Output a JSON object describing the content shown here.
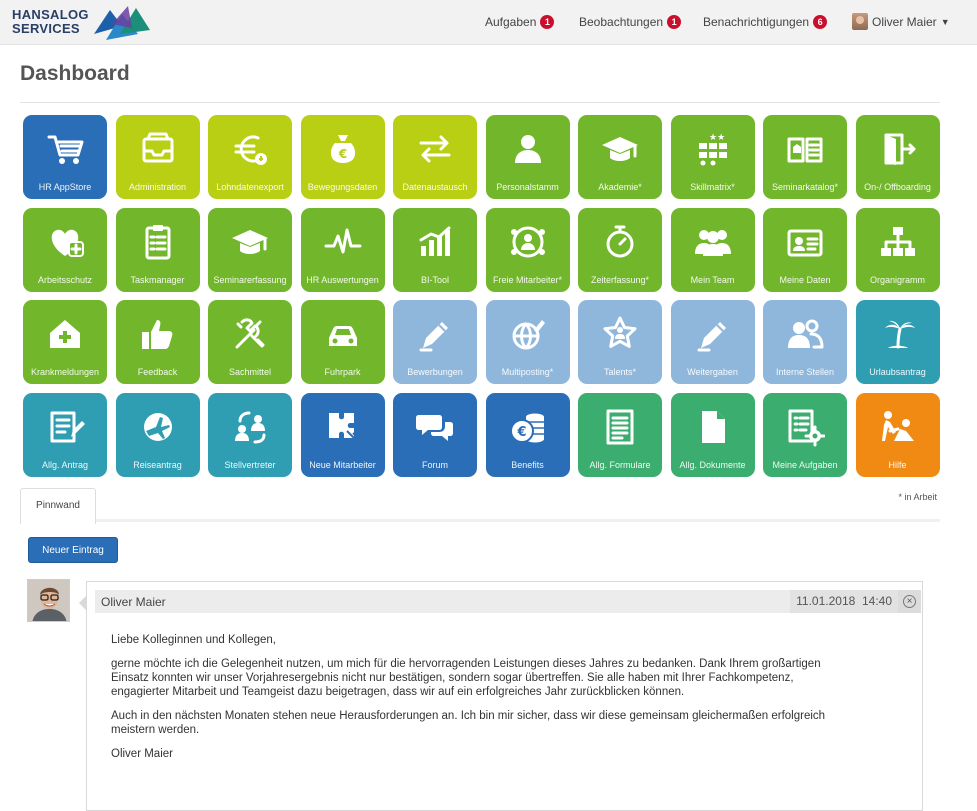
{
  "brand": {
    "line1": "HANSALOG",
    "line2": "SERVICES"
  },
  "nav": [
    {
      "label": "Aufgaben",
      "count": "1"
    },
    {
      "label": "Beobachtungen",
      "count": "1"
    },
    {
      "label": "Benachrichtigungen",
      "count": "6"
    }
  ],
  "user": {
    "name": "Oliver Maier"
  },
  "page_title": "Dashboard",
  "colors": {
    "blue_dark": "#2a6eb7",
    "lime": "#b9cf14",
    "green": "#72b62b",
    "light_blue": "#8fb7dc",
    "teal": "#2f9eb3",
    "emerald": "#3aad6f",
    "orange": "#f08a13"
  },
  "tiles": [
    {
      "label": "HR AppStore",
      "icon": "cart-icon",
      "color": "blue_dark"
    },
    {
      "label": "Administration",
      "icon": "inbox-icon",
      "color": "lime"
    },
    {
      "label": "Lohndatenexport",
      "icon": "euro-icon",
      "color": "lime"
    },
    {
      "label": "Bewegungsdaten",
      "icon": "money-bag-icon",
      "color": "lime"
    },
    {
      "label": "Datenaustausch",
      "icon": "exchange-icon",
      "color": "lime"
    },
    {
      "label": "Personalstamm",
      "icon": "person-icon",
      "color": "green"
    },
    {
      "label": "Akademie*",
      "icon": "graduation-cap-icon",
      "color": "green"
    },
    {
      "label": "Skillmatrix*",
      "icon": "skill-matrix-icon",
      "color": "green"
    },
    {
      "label": "Seminarkatalog*",
      "icon": "catalog-icon",
      "color": "green"
    },
    {
      "label": "On-/ Offboarding",
      "icon": "door-exit-icon",
      "color": "green"
    },
    {
      "label": "Arbeitsschutz",
      "icon": "heart-plus-icon",
      "color": "green"
    },
    {
      "label": "Taskmanager",
      "icon": "clipboard-list-icon",
      "color": "green"
    },
    {
      "label": "Seminarerfassung",
      "icon": "graduation-cap-icon",
      "color": "green"
    },
    {
      "label": "HR Auswertungen",
      "icon": "pulse-icon",
      "color": "green"
    },
    {
      "label": "BI-Tool",
      "icon": "bar-chart-icon",
      "color": "green"
    },
    {
      "label": "Freie Mitarbeiter*",
      "icon": "network-person-icon",
      "color": "green"
    },
    {
      "label": "Zeiterfassung*",
      "icon": "stopwatch-icon",
      "color": "green"
    },
    {
      "label": "Mein Team",
      "icon": "team-icon",
      "color": "green"
    },
    {
      "label": "Meine Daten",
      "icon": "id-card-icon",
      "color": "green"
    },
    {
      "label": "Organigramm",
      "icon": "org-chart-icon",
      "color": "green"
    },
    {
      "label": "Krankmeldungen",
      "icon": "house-cross-icon",
      "color": "green"
    },
    {
      "label": "Feedback",
      "icon": "thumbs-up-icon",
      "color": "green"
    },
    {
      "label": "Sachmittel",
      "icon": "tools-icon",
      "color": "green"
    },
    {
      "label": "Fuhrpark",
      "icon": "car-icon",
      "color": "green"
    },
    {
      "label": "Bewerbungen",
      "icon": "pen-icon",
      "color": "light_blue"
    },
    {
      "label": "Multiposting*",
      "icon": "globe-pen-icon",
      "color": "light_blue"
    },
    {
      "label": "Talents*",
      "icon": "star-person-icon",
      "color": "light_blue"
    },
    {
      "label": "Weitergaben",
      "icon": "pen-icon",
      "color": "light_blue"
    },
    {
      "label": "Interne Stellen",
      "icon": "people-icon",
      "color": "light_blue"
    },
    {
      "label": "Urlaubsantrag",
      "icon": "palm-island-icon",
      "color": "teal"
    },
    {
      "label": "Allg. Antrag",
      "icon": "form-pen-icon",
      "color": "teal"
    },
    {
      "label": "Reiseantrag",
      "icon": "plane-globe-icon",
      "color": "teal"
    },
    {
      "label": "Stellvertreter",
      "icon": "swap-people-icon",
      "color": "teal"
    },
    {
      "label": "Neue Mitarbeiter",
      "icon": "puzzle-icon",
      "color": "blue_dark"
    },
    {
      "label": "Forum",
      "icon": "chat-bubbles-icon",
      "color": "blue_dark"
    },
    {
      "label": "Benefits",
      "icon": "coins-euro-icon",
      "color": "blue_dark"
    },
    {
      "label": "Allg. Formulare",
      "icon": "form-icon",
      "color": "emerald"
    },
    {
      "label": "Allg. Dokumente",
      "icon": "document-icon",
      "color": "emerald"
    },
    {
      "label": "Meine Aufgaben",
      "icon": "tasks-gear-icon",
      "color": "emerald"
    },
    {
      "label": "Hilfe",
      "icon": "help-people-icon",
      "color": "orange"
    }
  ],
  "tabs": [
    {
      "label": "Pinnwand"
    }
  ],
  "footnote": "* in Arbeit",
  "new_entry_label": "Neuer Eintrag",
  "post": {
    "author": "Oliver Maier",
    "date": "11.01.2018",
    "time": "14:40",
    "greeting": "Liebe Kolleginnen und Kollegen,",
    "para1": "gerne möchte ich die Gelegenheit nutzen, um mich für die hervorragenden Leistungen dieses Jahres zu bedanken. Dank Ihrem großartigen Einsatz konnten wir unser Vorjahresergebnis nicht nur bestätigen, sondern sogar übertreffen. Sie alle haben mit Ihrer Fachkompetenz, engagierter Mitarbeit und Teamgeist dazu beigetragen, dass wir auf ein erfolgreiches Jahr zurückblicken können.",
    "para2": "Auch in den nächsten Monaten stehen neue Herausforderungen an. Ich bin mir sicher, dass wir diese gemeinsam gleichermaßen erfolgreich meistern werden.",
    "signature": "Oliver Maier"
  }
}
